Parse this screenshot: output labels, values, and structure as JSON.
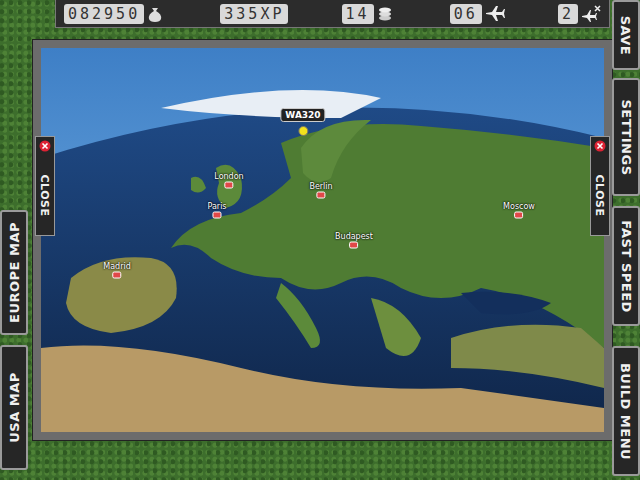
{
  "hud": {
    "money": "082950",
    "xp": "335XP",
    "coins": "14",
    "planes": "06",
    "runways": "2"
  },
  "side_left": [
    "EUROPE MAP",
    "USA MAP"
  ],
  "side_right": [
    "SAVE",
    "SETTINGS",
    "FAST SPEED",
    "BUILD MENU"
  ],
  "close_buttons": [
    "CLOSE",
    "CLOSE"
  ],
  "map": {
    "cities": [
      {
        "name": "London"
      },
      {
        "name": "Paris"
      },
      {
        "name": "Berlin"
      },
      {
        "name": "Budapest"
      },
      {
        "name": "Moscow"
      },
      {
        "name": "Madrid"
      }
    ],
    "flight": {
      "code": "WA320"
    }
  }
}
